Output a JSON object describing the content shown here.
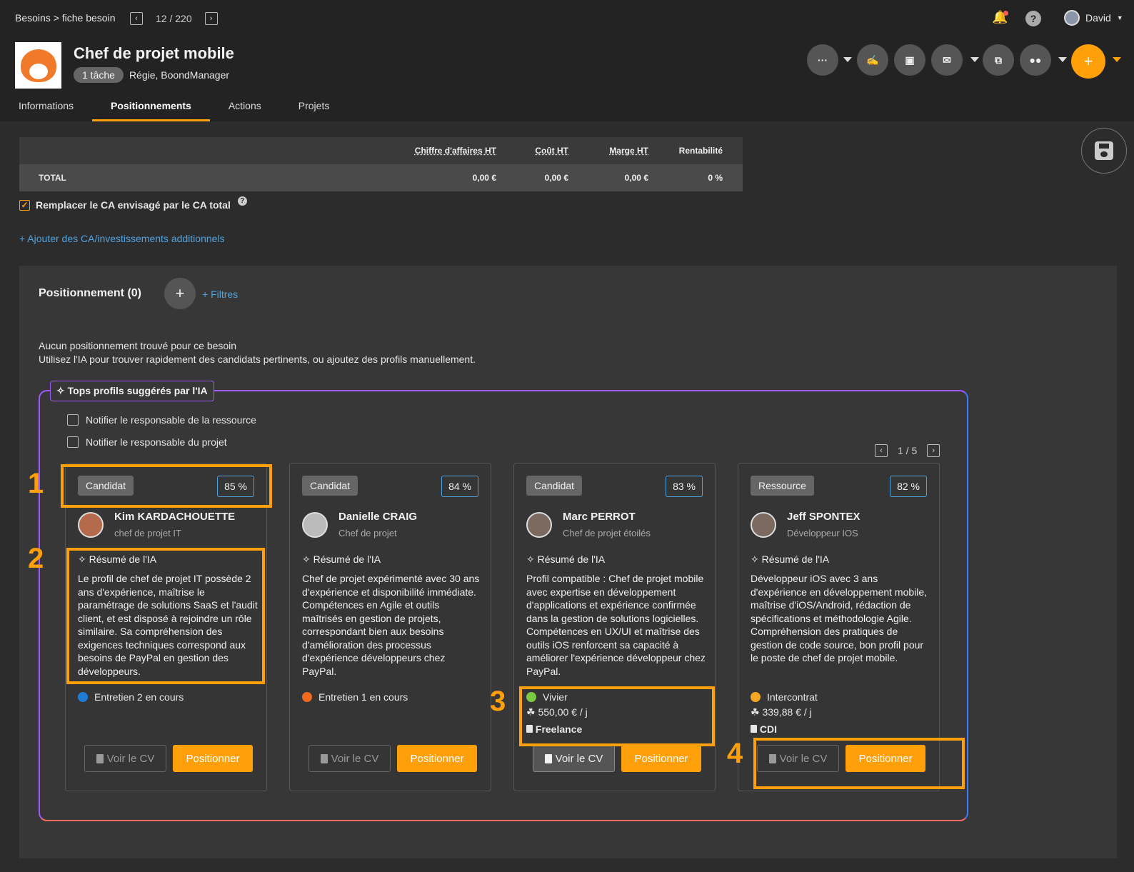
{
  "breadcrumb": "Besoins > fiche besoin",
  "pager": {
    "text": "12 / 220"
  },
  "user": {
    "name": "David"
  },
  "title": "Chef de projet mobile",
  "task_badge": "1 tâche",
  "subtitle": "Régie, BoondManager",
  "tabs": [
    "Informations",
    "Positionnements",
    "Actions",
    "Projets"
  ],
  "active_tab": "Positionnements",
  "finance": {
    "headers": [
      "Chiffre d'affaires HT",
      "Coût HT",
      "Marge HT",
      "Rentabilité"
    ],
    "row_label": "TOTAL",
    "values": [
      "0,00 €",
      "0,00 €",
      "0,00 €",
      "0 %"
    ]
  },
  "replace_ca_label": "Remplacer le CA envisagé par le CA total",
  "add_ca_link": "+ Ajouter des CA/investissements additionnels",
  "positioning": {
    "title": "Positionnement (0)",
    "filters": "+ Filtres",
    "empty_line1": "Aucun positionnement trouvé pour ce besoin",
    "empty_line2": "Utilisez l'IA pour trouver rapidement des candidats pertinents, ou ajoutez des profils manuellement."
  },
  "ai": {
    "label": "Tops profils suggérés par l'IA",
    "notify_resource": "Notifier le responsable de la ressource",
    "notify_project": "Notifier le responsable du projet",
    "pager": "1 / 5"
  },
  "cards": [
    {
      "tag": "Candidat",
      "score": "85 %",
      "name": "Kim KARDACHOUETTE",
      "role": "chef de projet IT",
      "summary_title": "Résumé de l'IA",
      "summary": "Le profil de chef de projet IT possède 2 ans d'expérience, maîtrise le paramétrage de solutions SaaS et l'audit client, et est disposé à rejoindre un rôle similaire. Sa compréhension des exigences techniques correspond aux besoins de PayPal en gestion des développeurs.",
      "status": "Entretien 2 en cours",
      "status_color": "#1e7bd6",
      "price": "",
      "type": "",
      "cv": "Voir le CV",
      "position": "Positionner"
    },
    {
      "tag": "Candidat",
      "score": "84 %",
      "name": "Danielle CRAIG",
      "role": "Chef de projet",
      "summary_title": "Résumé de l'IA",
      "summary": "Chef de projet expérimenté avec 30 ans d'expérience et disponibilité immédiate. Compétences en Agile et outils maîtrisés en gestion de projets, correspondant bien aux besoins d'amélioration des processus d'expérience développeurs chez PayPal.",
      "status": "Entretien 1 en cours",
      "status_color": "#f26a1b",
      "price": "",
      "type": "",
      "cv": "Voir le CV",
      "position": "Positionner"
    },
    {
      "tag": "Candidat",
      "score": "83 %",
      "name": "Marc PERROT",
      "role": "Chef de projet étoilés",
      "summary_title": "Résumé de l'IA",
      "summary": "Profil compatible : Chef de projet mobile avec expertise en développement d'applications et expérience confirmée dans la gestion de solutions logicielles. Compétences en UX/UI et maîtrise des outils iOS renforcent sa capacité à améliorer l'expérience développeur chez PayPal.",
      "status": "Vivier",
      "status_color": "#7ac943",
      "price": "550,00 € / j",
      "type": "Freelance",
      "cv": "Voir le CV",
      "position": "Positionner"
    },
    {
      "tag": "Ressource",
      "score": "82 %",
      "name": "Jeff SPONTEX",
      "role": "Développeur IOS",
      "summary_title": "Résumé de l'IA",
      "summary": "Développeur iOS avec 3 ans d'expérience en développement mobile, maîtrise d'iOS/Android, rédaction de spécifications et méthodologie Agile. Compréhension des pratiques de gestion de code source, bon profil pour le poste de chef de projet mobile.",
      "status": "Intercontrat",
      "status_color": "#f5a623",
      "price": "339,88 € / j",
      "type": "CDI",
      "cv": "Voir le CV",
      "position": "Positionner"
    }
  ],
  "annotations": [
    "1",
    "2",
    "3",
    "4"
  ],
  "colors": {
    "accent": "#ff9f0a",
    "link": "#4fa3e0",
    "ai_border": "#9b59ff"
  }
}
